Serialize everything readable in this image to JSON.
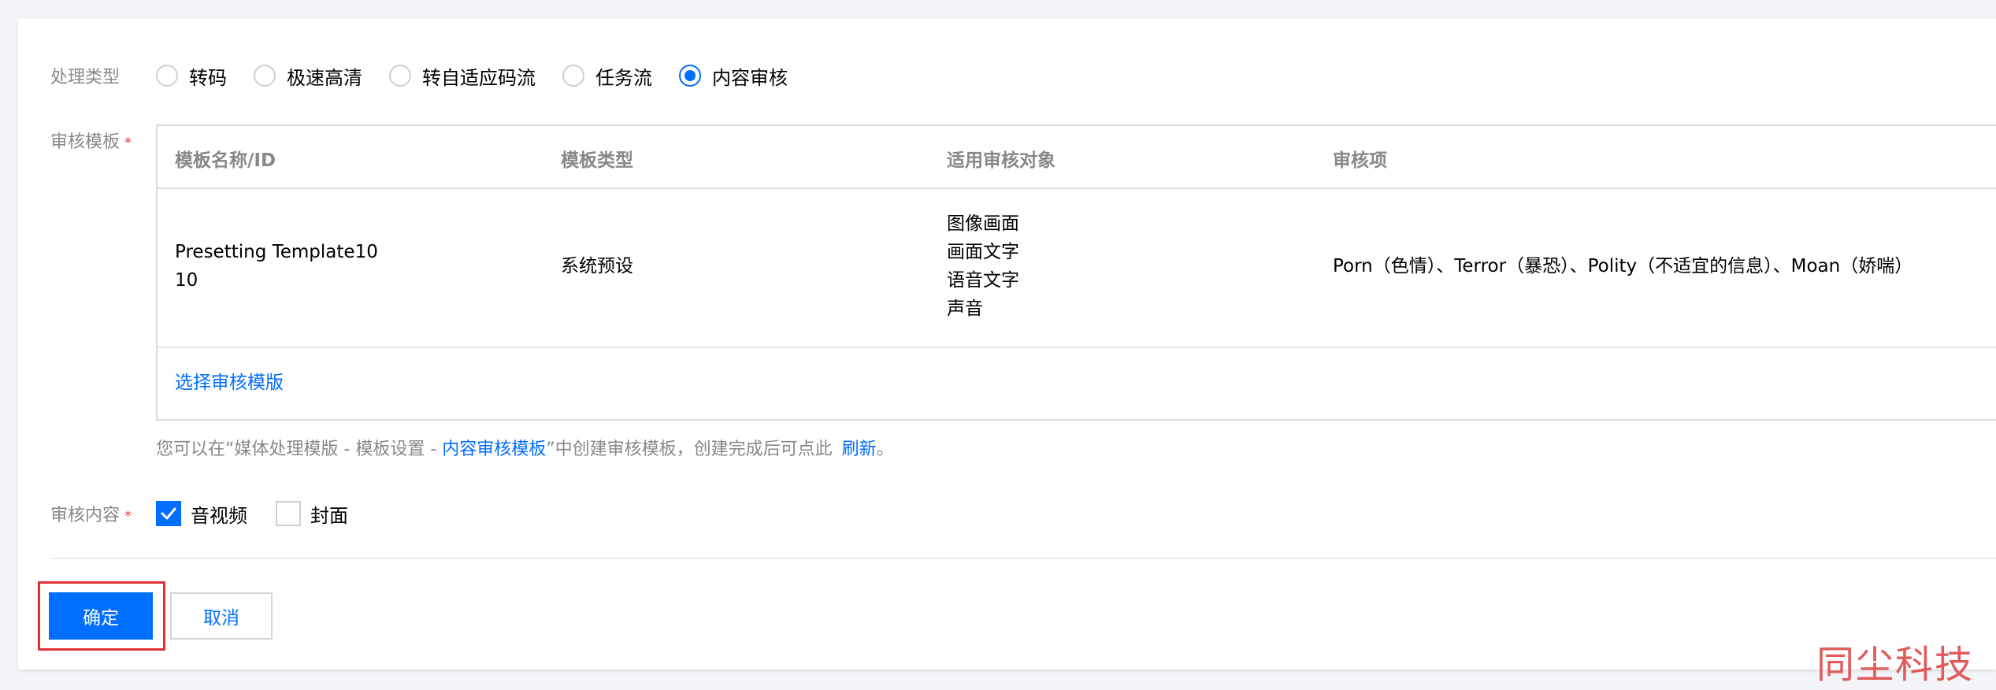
{
  "process_type": {
    "label": "处理类型",
    "options": [
      "转码",
      "极速高清",
      "转自适应码流",
      "任务流",
      "内容审核"
    ],
    "selected": "内容审核"
  },
  "review_template": {
    "label": "审核模板",
    "required_mark": "*",
    "table": {
      "headers": [
        "模板名称/ID",
        "模板类型",
        "适用审核对象",
        "审核项"
      ],
      "rows": [
        {
          "name_line1": "Presetting Template10",
          "name_line2": "10",
          "type": "系统预设",
          "objects": [
            "图像画面",
            "画面文字",
            "语音文字",
            "声音"
          ],
          "items": "Porn（色情）、Terror（暴恐）、Polity（不适宜的信息）、Moan（娇喘）"
        }
      ],
      "select_link": "选择审核模版"
    },
    "hint": {
      "prefix": "您可以在“媒体处理模版 - 模板设置 - ",
      "link1": "内容审核模板",
      "middle": "”中创建审核模板，创建完成后可点此",
      "link2": "刷新",
      "suffix": "。"
    }
  },
  "review_content": {
    "label": "审核内容",
    "required_mark": "*",
    "options": [
      {
        "label": "音视频",
        "checked": true
      },
      {
        "label": "封面",
        "checked": false
      }
    ]
  },
  "buttons": {
    "confirm": "确定",
    "cancel": "取消"
  },
  "watermark": "同尘科技",
  "colors": {
    "accent": "#006eff",
    "required": "#e54545",
    "highlight": "#e03030"
  }
}
